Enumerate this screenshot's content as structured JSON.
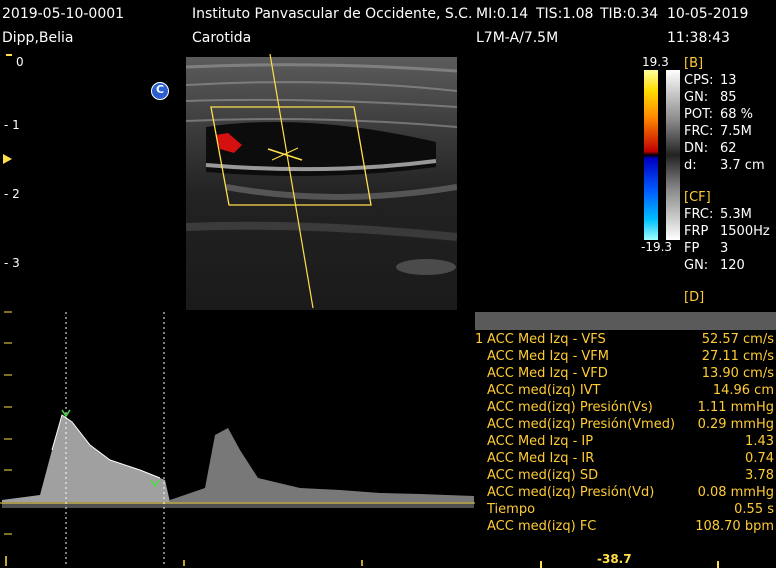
{
  "header": {
    "study_id": "2019-05-10-0001",
    "institution": "Instituto Panvascular de Occidente, S.C.",
    "mi": "MI:0.14",
    "tis": "TIS:1.08",
    "tib": "TIB:0.34",
    "date": "10-05-2019",
    "patient": "Dipp,Belia",
    "exam": "Carotida",
    "probe": "L7M-A/7.5M",
    "time": "11:38:43"
  },
  "depth_scale": [
    "0",
    "- 1",
    "- 2",
    "- 3"
  ],
  "color_bar": {
    "max": "19.3",
    "min": "-19.3"
  },
  "marker_c": "C",
  "b_params": {
    "section": "[B]",
    "items": [
      {
        "label": "CPS:",
        "value": "13"
      },
      {
        "label": "GN:",
        "value": "85"
      },
      {
        "label": "POT:",
        "value": "68 %"
      },
      {
        "label": "FRC:",
        "value": "7.5M"
      },
      {
        "label": "DN:",
        "value": "62"
      },
      {
        "label": "d:",
        "value": "3.7 cm"
      }
    ]
  },
  "cf_params": {
    "section": "[CF]",
    "items": [
      {
        "label": "FRC:",
        "value": "5.3M"
      },
      {
        "label": "FRP",
        "value": "1500Hz"
      },
      {
        "label": "FP",
        "value": "3"
      },
      {
        "label": "GN:",
        "value": "120"
      }
    ]
  },
  "d_section": "[D]",
  "measurements": [
    {
      "num": "1",
      "label": "ACC  Med Izq - VFS",
      "value": "52.57 cm/s"
    },
    {
      "num": "",
      "label": "ACC Med Izq - VFM",
      "value": "27.11 cm/s"
    },
    {
      "num": "",
      "label": "ACC Med Izq - VFD",
      "value": "13.90 cm/s"
    },
    {
      "num": "",
      "label": "ACC med(izq) IVT",
      "value": "14.96 cm"
    },
    {
      "num": "",
      "label": "ACC med(izq) Presión(Vs)",
      "value": "1.11 mmHg"
    },
    {
      "num": "",
      "label": "ACC med(izq) Presión(Vmed)",
      "value": "0.29 mmHg"
    },
    {
      "num": "",
      "label": "ACC Med Izq - IP",
      "value": "1.43"
    },
    {
      "num": "",
      "label": "ACC Med Izq - IR",
      "value": "0.74"
    },
    {
      "num": "",
      "label": "ACC med(izq) SD",
      "value": "3.78"
    },
    {
      "num": "",
      "label": "ACC med(izq) Presión(Vd)",
      "value": "0.08 mmHg"
    },
    {
      "num": "",
      "label": "Tiempo",
      "value": "0.55 s"
    },
    {
      "num": "",
      "label": "ACC med(izq) FC",
      "value": "108.70 bpm"
    }
  ],
  "spectrum_bottom_value": "-38.7",
  "colors": {
    "label_orange": "#ffcc33",
    "overlay_yellow": "#ffe04a",
    "caliper_green": "#44dd44",
    "marker_blue": "#2a5fcf"
  }
}
